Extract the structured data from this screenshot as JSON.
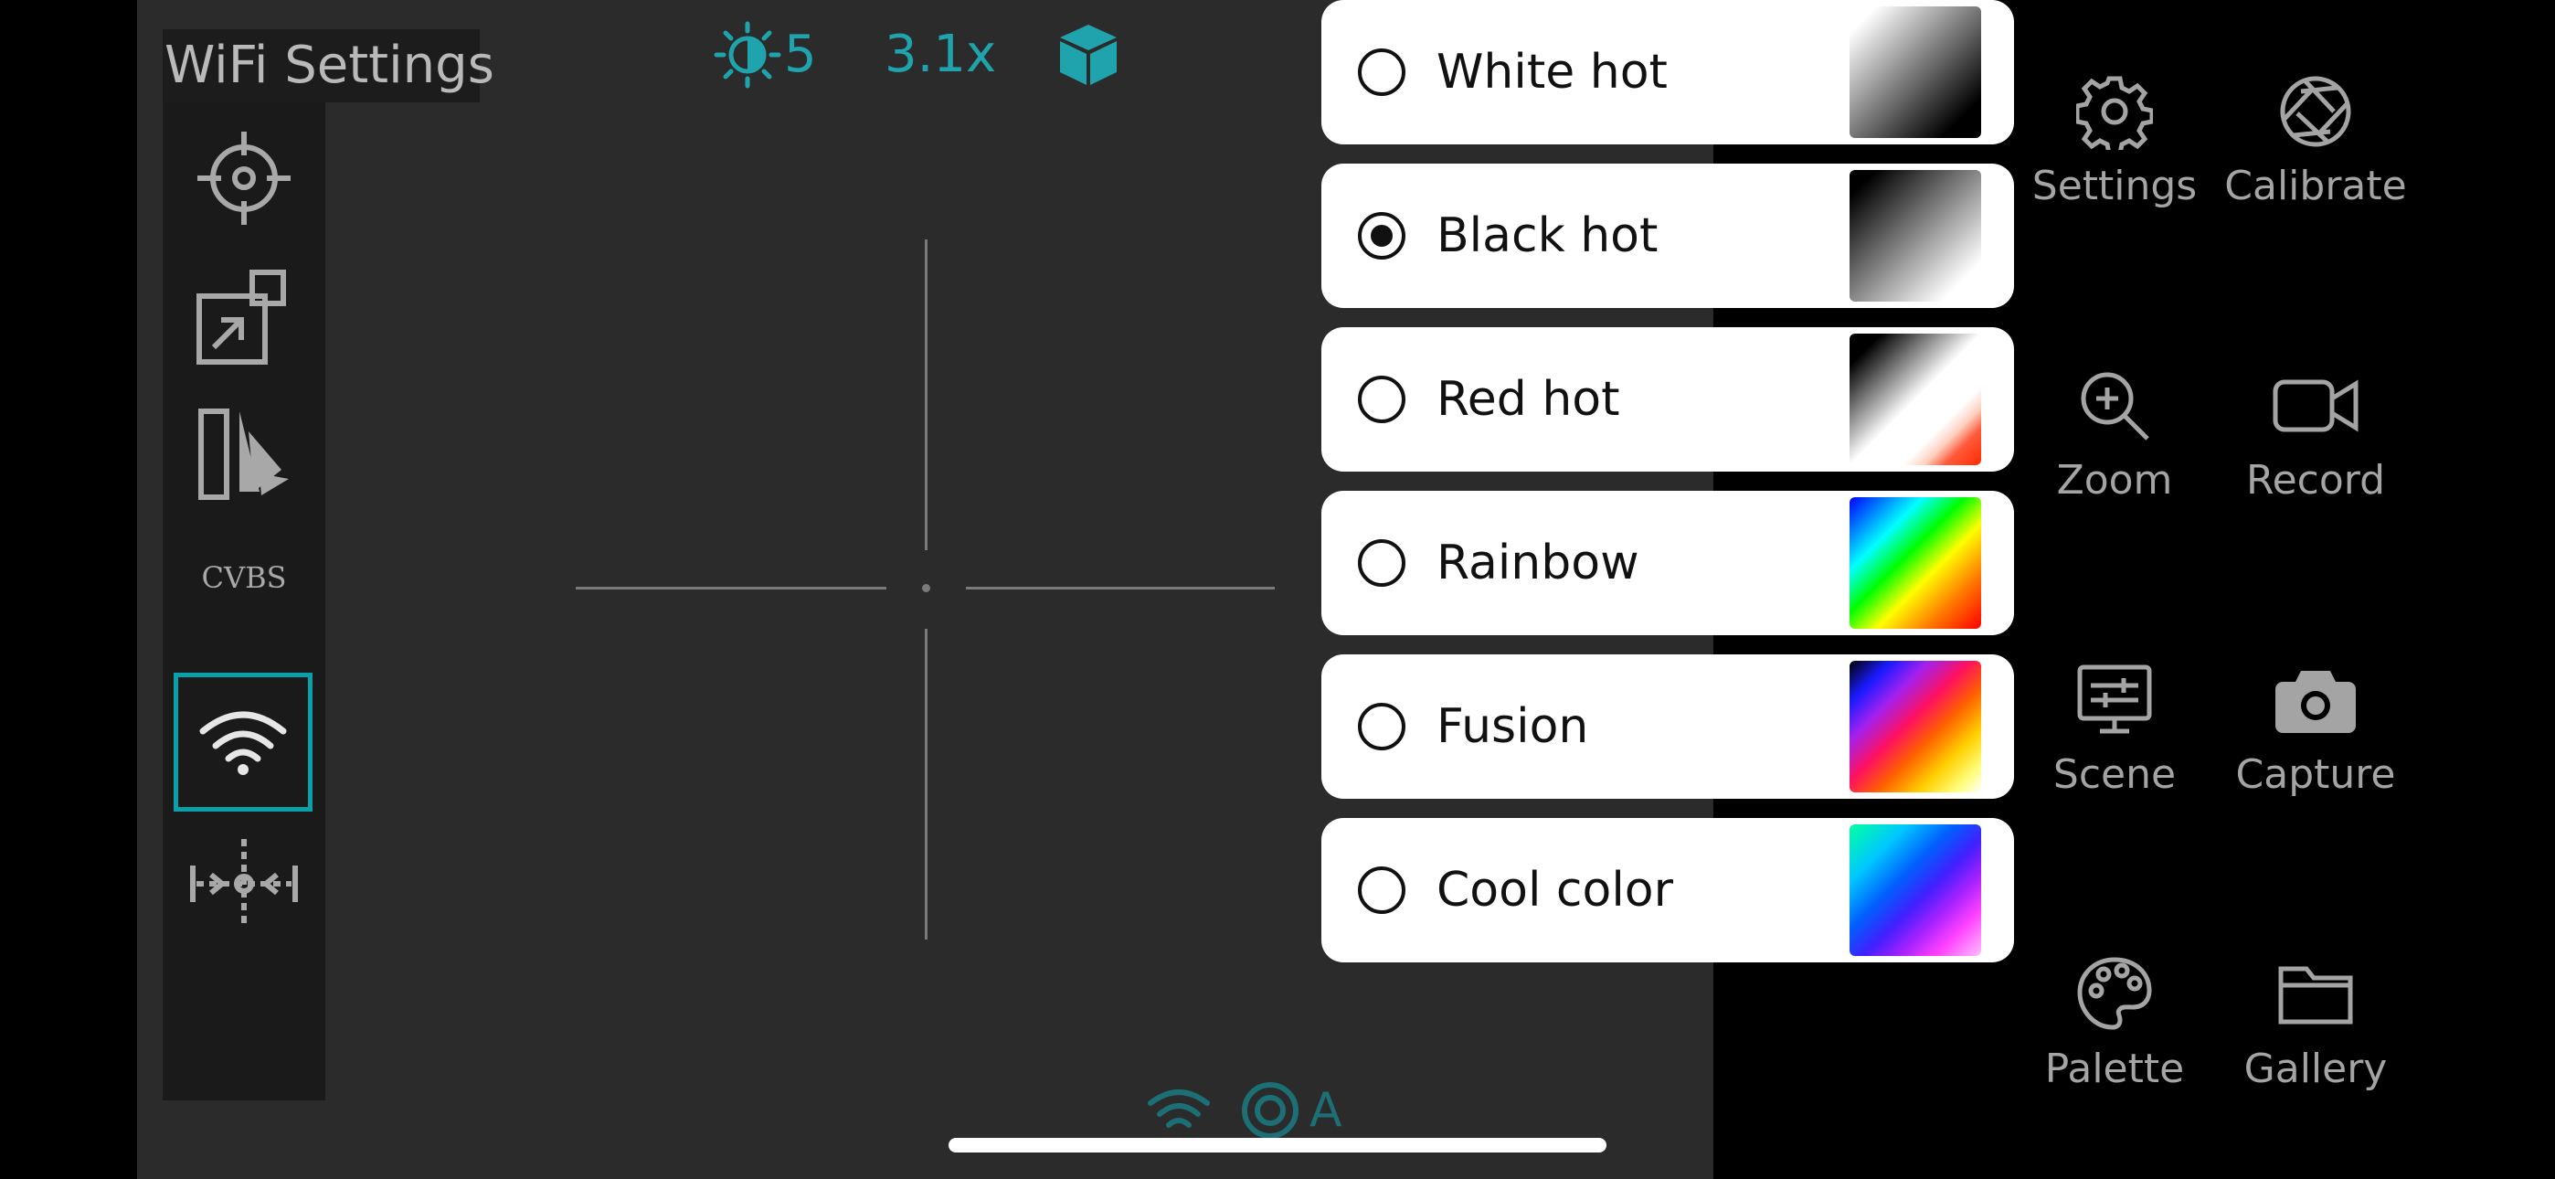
{
  "title": "WiFi Settings",
  "status_bar": {
    "brightness_value": "5",
    "zoom_value": "3.1x",
    "bottom_mode": "A"
  },
  "left_menu": {
    "cvbs_label": "CVBS"
  },
  "palette": {
    "selected": "Black hot",
    "options": [
      {
        "label": "White hot",
        "selected": false
      },
      {
        "label": "Black hot",
        "selected": true
      },
      {
        "label": "Red hot",
        "selected": false
      },
      {
        "label": "Rainbow",
        "selected": false
      },
      {
        "label": "Fusion",
        "selected": false
      },
      {
        "label": "Cool color",
        "selected": false
      }
    ]
  },
  "side_menu": {
    "settings": "Settings",
    "calibrate": "Calibrate",
    "zoom": "Zoom",
    "record": "Record",
    "scene": "Scene",
    "capture": "Capture",
    "palette": "Palette",
    "gallery": "Gallery"
  },
  "colors": {
    "accent": "#1fa4ad",
    "viewfinder_bg": "#2b2b2b",
    "menu_bg": "#1a1a1a"
  }
}
